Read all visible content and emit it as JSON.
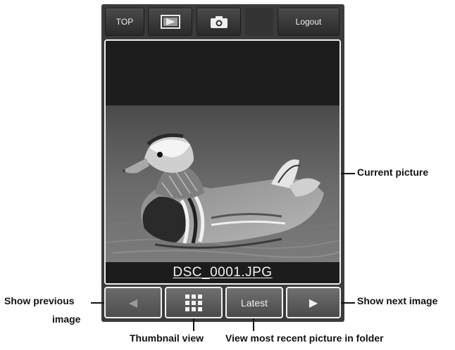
{
  "toolbar": {
    "top_label": "TOP",
    "play_icon": "playback-icon",
    "camera_icon": "camera-icon",
    "logout_label": "Logout"
  },
  "picture": {
    "filename": "DSC_0001.JPG"
  },
  "nav": {
    "prev_icon": "◀",
    "thumbnail_icon": "grid-icon",
    "latest_label": "Latest",
    "next_icon": "▶"
  },
  "callouts": {
    "current_picture": "Current picture",
    "show_previous_line1": "Show previous",
    "show_previous_line2": "image",
    "show_next": "Show next image",
    "thumbnail_view": "Thumbnail view",
    "view_most_recent": "View most recent picture in folder"
  }
}
